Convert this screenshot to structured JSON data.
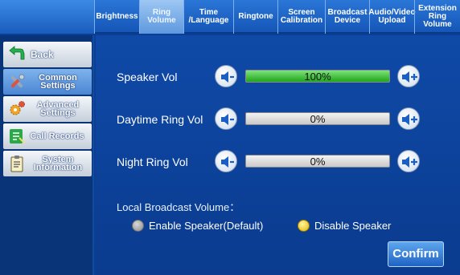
{
  "tabs": [
    {
      "label": "Brightness",
      "active": false
    },
    {
      "label": "Ring\nVolume",
      "active": true
    },
    {
      "label": "Time\n/Language",
      "active": false
    },
    {
      "label": "Ringtone",
      "active": false
    },
    {
      "label": "Screen\nCalibration",
      "active": false
    },
    {
      "label": "Broadcast\nDevice",
      "active": false
    },
    {
      "label": "Audio/Video\nUpload",
      "active": false
    },
    {
      "label": "Extension\nRing Volume",
      "active": false
    }
  ],
  "sidebar": {
    "items": [
      {
        "label": "Back",
        "icon": "back-arrow-icon"
      },
      {
        "label": "Common\nSettings",
        "icon": "tools-icon",
        "selected": true
      },
      {
        "label": "Advanced\nSettings",
        "icon": "gears-icon"
      },
      {
        "label": "Call Records",
        "icon": "call-records-icon"
      },
      {
        "label": "System\nInformation",
        "icon": "info-clipboard-icon"
      }
    ]
  },
  "volumes": [
    {
      "label": "Speaker Vol",
      "percent_label": "100%",
      "level": 100
    },
    {
      "label": "Daytime Ring Vol",
      "percent_label": "0%",
      "level": 0
    },
    {
      "label": "Night Ring Vol",
      "percent_label": "0%",
      "level": 0
    }
  ],
  "broadcast": {
    "title": "Local Broadcast Volume：",
    "options": [
      {
        "label": "Enable Speaker(Default)",
        "selected": false
      },
      {
        "label": "Disable Speaker",
        "selected": true
      }
    ]
  },
  "confirm_label": "Confirm",
  "colors": {
    "background": "#0b3f95",
    "accent": "#1fa51a",
    "selected_radio": "#e3b400"
  }
}
